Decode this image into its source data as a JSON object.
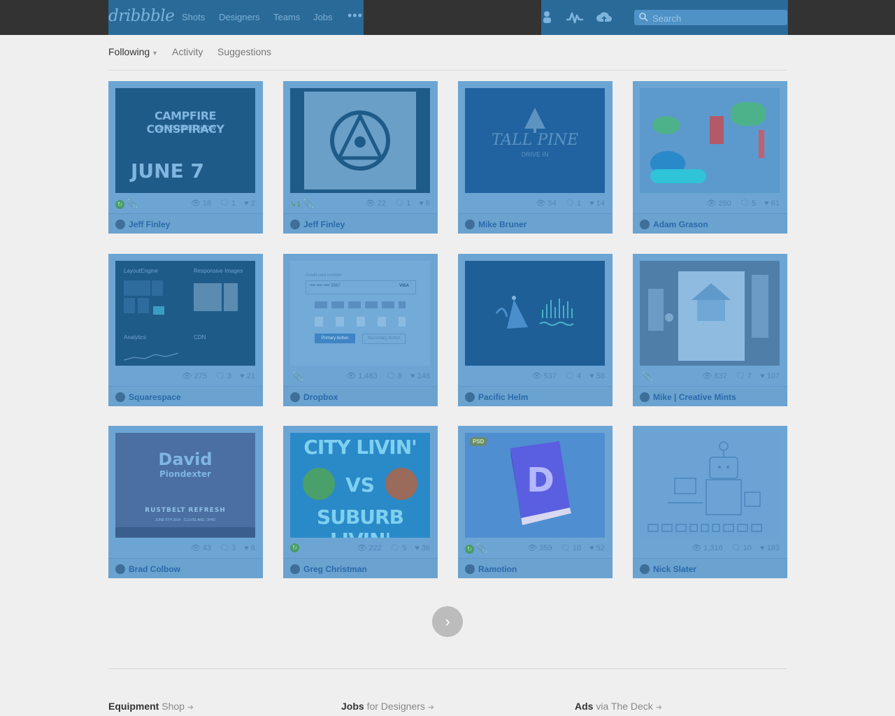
{
  "header": {
    "logo": "dribbble",
    "nav": [
      "Shots",
      "Designers",
      "Teams",
      "Jobs"
    ],
    "more": "•••",
    "icons": [
      "user-icon",
      "activity-icon",
      "upload-icon"
    ],
    "search_placeholder": "Search"
  },
  "tabs": [
    {
      "label": "Following",
      "active": true,
      "has_caret": true
    },
    {
      "label": "Activity",
      "active": false
    },
    {
      "label": "Suggestions",
      "active": false
    }
  ],
  "shots": [
    {
      "player": "Jeff Finley",
      "views": "18",
      "comments": "1",
      "likes": "2",
      "rebound": true,
      "attachment": true,
      "thumb_lines": [
        "CAMPFIRE CONSPIRACY",
        "CD RELEASE SHOW",
        "JUNE 7"
      ]
    },
    {
      "player": "Jeff Finley",
      "views": "22",
      "comments": "1",
      "likes": "6",
      "rebounds": "1",
      "attachment": true
    },
    {
      "player": "Mike Bruner",
      "views": "54",
      "comments": "1",
      "likes": "14",
      "thumb_lines": [
        "TALL PINE",
        "DRIVE IN"
      ]
    },
    {
      "player": "Adam Grason",
      "views": "260",
      "comments": "5",
      "likes": "61"
    },
    {
      "player": "Squarespace",
      "views": "275",
      "comments": "3",
      "likes": "21",
      "thumb_lines": [
        "LayoutEngine",
        "Responsive Images",
        "Analytics",
        "CDN"
      ]
    },
    {
      "player": "Dropbox",
      "views": "1,483",
      "comments": "8",
      "likes": "146",
      "attachment": true,
      "thumb_lines": [
        "Credit card number",
        "•••• •••• •••• 3567",
        "VISA",
        "Primary button",
        "Secondary button"
      ]
    },
    {
      "player": "Pacific Helm",
      "views": "537",
      "comments": "4",
      "likes": "58"
    },
    {
      "player": "Mike | Creative Mints",
      "views": "837",
      "comments": "7",
      "likes": "107",
      "attachment": true
    },
    {
      "player": "Brad Colbow",
      "views": "43",
      "comments": "3",
      "likes": "6",
      "thumb_lines": [
        "David",
        "Piondexter",
        "RUSTBELT REFRESH",
        "JUNE 6TH 2014 · CLEVELAND, OHIO"
      ]
    },
    {
      "player": "Greg Christman",
      "views": "222",
      "comments": "5",
      "likes": "36",
      "rebound": true,
      "thumb_lines": [
        "CITY LIVIN'",
        "VS",
        "SUBURB LIVIN'"
      ]
    },
    {
      "player": "Ramotion",
      "views": "359",
      "comments": "10",
      "likes": "52",
      "rebound": true,
      "attachment": true,
      "thumb_lines": [
        "PSD"
      ]
    },
    {
      "player": "Nick Slater",
      "views": "1,316",
      "comments": "10",
      "likes": "183"
    }
  ],
  "pagination": {
    "next_label": "›"
  },
  "footer": [
    {
      "title": "Equipment",
      "sub": "Shop"
    },
    {
      "title": "Jobs",
      "sub": "for Designers"
    },
    {
      "title": "Ads",
      "sub": "via The Deck"
    }
  ],
  "colors": {
    "topbar": "#333333",
    "overlay_blue": "#6ca5d4",
    "link_blue": "#2a6aa8",
    "page_bg": "#efefef"
  }
}
